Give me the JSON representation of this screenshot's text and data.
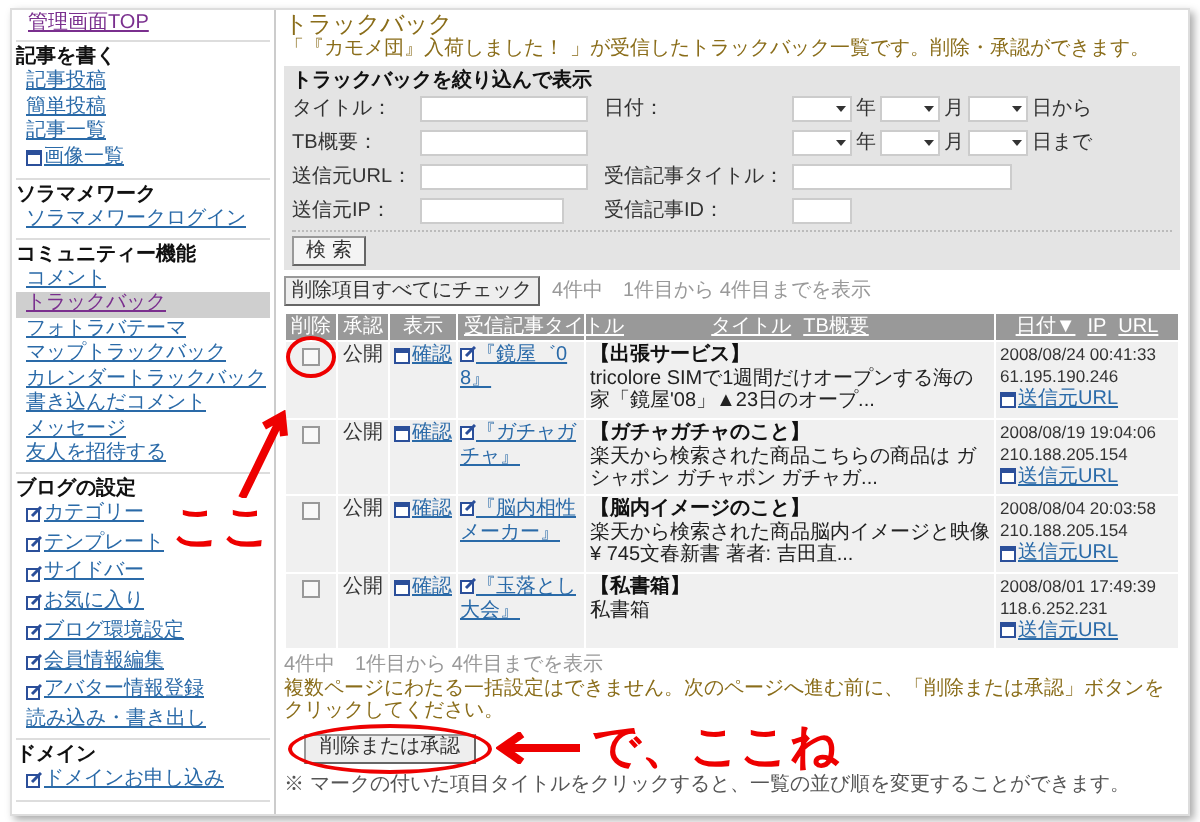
{
  "sidebar": {
    "top_link": "管理画面TOP",
    "sections": [
      {
        "heading": "記事を書く",
        "items": [
          {
            "label": "記事投稿",
            "kind": "plain",
            "selected": false
          },
          {
            "label": "簡単投稿",
            "kind": "plain",
            "selected": false
          },
          {
            "label": "記事一覧",
            "kind": "plain",
            "selected": false
          },
          {
            "label": "画像一覧",
            "kind": "window",
            "selected": false
          }
        ]
      },
      {
        "heading": "ソラマメワーク",
        "items": [
          {
            "label": "ソラマメワークログイン",
            "kind": "plain",
            "selected": false
          }
        ]
      },
      {
        "heading": "コミュニティー機能",
        "items": [
          {
            "label": "コメント",
            "kind": "plain",
            "selected": false
          },
          {
            "label": "トラックバック",
            "kind": "plain",
            "selected": true
          },
          {
            "label": "フォトラバテーマ",
            "kind": "plain",
            "selected": false
          },
          {
            "label": "マップトラックバック",
            "kind": "plain",
            "selected": false
          },
          {
            "label": "カレンダートラックバック",
            "kind": "plain",
            "selected": false
          },
          {
            "label": "書き込んだコメント",
            "kind": "plain",
            "selected": false
          },
          {
            "label": "メッセージ",
            "kind": "plain",
            "selected": false
          },
          {
            "label": "友人を招待する",
            "kind": "plain",
            "selected": false
          }
        ]
      },
      {
        "heading": "ブログの設定",
        "items": [
          {
            "label": "カテゴリー",
            "kind": "edit",
            "selected": false
          },
          {
            "label": "テンプレート",
            "kind": "edit",
            "selected": false
          },
          {
            "label": "サイドバー",
            "kind": "edit",
            "selected": false
          },
          {
            "label": "お気に入り",
            "kind": "edit",
            "selected": false
          },
          {
            "label": "ブログ環境設定",
            "kind": "edit",
            "selected": false
          },
          {
            "label": "会員情報編集",
            "kind": "edit",
            "selected": false
          },
          {
            "label": "アバター情報登録",
            "kind": "edit",
            "selected": false
          },
          {
            "label": "読み込み・書き出し",
            "kind": "plain",
            "selected": false
          }
        ]
      },
      {
        "heading": "ドメイン",
        "items": [
          {
            "label": "ドメインお申し込み",
            "kind": "edit",
            "selected": false
          }
        ]
      }
    ]
  },
  "main": {
    "title": "トラックバック",
    "subtitle": "「『カモメ団』入荷しました！ 」が受信したトラックバック一覧です。削除・承認ができます。"
  },
  "filter": {
    "title": "トラックバックを絞り込んで表示",
    "fields": [
      {
        "label": "タイトル："
      },
      {
        "label": "TB概要："
      },
      {
        "label": "送信元URL："
      },
      {
        "label": "送信元IP："
      }
    ],
    "date_label": "日付：",
    "date_rows": [
      {
        "year": "年",
        "month": "月",
        "day": "日から"
      },
      {
        "year": "年",
        "month": "月",
        "day": "日まで"
      }
    ],
    "right_fields": [
      {
        "label": "受信記事タイトル："
      },
      {
        "label": "受信記事ID："
      }
    ],
    "search_button": "検 索"
  },
  "check_all_button": "削除項目すべてにチェック",
  "count_top": "4件中　1件目から 4件目までを表示",
  "table": {
    "columns": [
      {
        "labels": [
          "削除"
        ]
      },
      {
        "labels": [
          "承認"
        ]
      },
      {
        "labels": [
          "表示"
        ]
      },
      {
        "labels": [
          "受信記事タイトル"
        ]
      },
      {
        "labels": [
          "タイトル",
          "TB概要"
        ]
      },
      {
        "labels": [
          "日付▼",
          "IP",
          "URL"
        ]
      }
    ],
    "rows": [
      {
        "checked": false,
        "status": "公開",
        "view": "確認",
        "article": "『鏡屋゛08』",
        "title": "【出張サービス】",
        "summary": "tricolore SIMで1週間だけオープンする海の家「鏡屋'08」▲23日のオープ...",
        "date": "2008/08/24 00:41:33",
        "ip": "61.195.190.246",
        "url": "送信元URL"
      },
      {
        "checked": false,
        "status": "公開",
        "view": "確認",
        "article": "『ガチャガチャ』",
        "title": "【ガチャガチャのこと】",
        "summary": "楽天から検索された商品こちらの商品は ガシャポン ガチャポン ガチャガ...",
        "date": "2008/08/19 19:04:06",
        "ip": "210.188.205.154",
        "url": "送信元URL"
      },
      {
        "checked": false,
        "status": "公開",
        "view": "確認",
        "article": "『脳内相性メーカー』",
        "title": "【脳内イメージのこと】",
        "summary": "楽天から検索された商品脳内イメージと映像 ¥ 745文春新書 著者: 吉田直...",
        "date": "2008/08/04 20:03:58",
        "ip": "210.188.205.154",
        "url": "送信元URL"
      },
      {
        "checked": false,
        "status": "公開",
        "view": "確認",
        "article": "『玉落とし大会』",
        "title": "【私書箱】",
        "summary": "私書箱",
        "date": "2008/08/01 17:49:39",
        "ip": "118.6.252.231",
        "url": "送信元URL"
      }
    ]
  },
  "count_bottom": "4件中　1件目から 4件目までを表示",
  "note": "複数ページにわたる一括設定はできません。次のページへ進む前に、「削除または承認」ボタンをクリックしてください。",
  "submit_button": "削除または承認",
  "footnote": "※ マークの付いた項目タイトルをクリックすると、一覧の並び順を変更することができます。",
  "annotations": [
    {
      "text": "ここ"
    },
    {
      "text": "で、ここね"
    }
  ]
}
